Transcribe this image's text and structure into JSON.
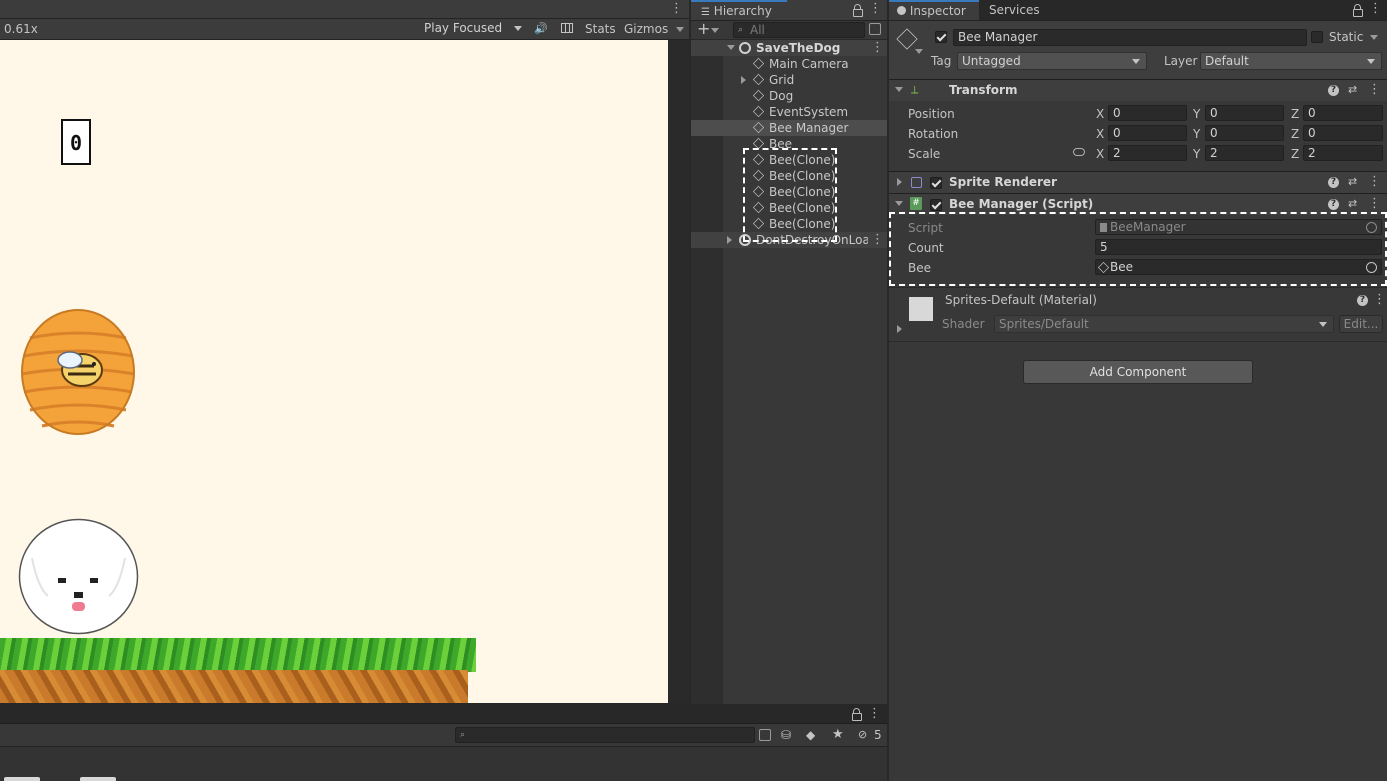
{
  "game_toolbar": {
    "zoom": "0.61x",
    "play_mode": "Play Focused",
    "stats": "Stats",
    "gizmos": "Gizmos"
  },
  "game_view": {
    "score": "0",
    "background_color": "#fff8e8"
  },
  "hierarchy": {
    "tab": "Hierarchy",
    "search_placeholder": "All",
    "scene": "SaveTheDog",
    "items": [
      {
        "label": "Main Camera"
      },
      {
        "label": "Grid"
      },
      {
        "label": "Dog"
      },
      {
        "label": "EventSystem"
      },
      {
        "label": "Bee Manager"
      },
      {
        "label": "Bee"
      },
      {
        "label": "Bee(Clone)"
      },
      {
        "label": "Bee(Clone)"
      },
      {
        "label": "Bee(Clone)"
      },
      {
        "label": "Bee(Clone)"
      },
      {
        "label": "Bee(Clone)"
      }
    ],
    "dont_destroy": "DontDestroyOnLoad"
  },
  "inspector": {
    "tab": "Inspector",
    "services_tab": "Services",
    "object_name": "Bee Manager",
    "static_label": "Static",
    "tag_label": "Tag",
    "tag_value": "Untagged",
    "layer_label": "Layer",
    "layer_value": "Default",
    "transform": {
      "title": "Transform",
      "position": {
        "label": "Position",
        "x": "0",
        "y": "0",
        "z": "0"
      },
      "rotation": {
        "label": "Rotation",
        "x": "0",
        "y": "0",
        "z": "0"
      },
      "scale": {
        "label": "Scale",
        "x": "2",
        "y": "2",
        "z": "2"
      }
    },
    "axis": {
      "x": "X",
      "y": "Y",
      "z": "Z"
    },
    "sprite_renderer": {
      "title": "Sprite Renderer"
    },
    "script_component": {
      "title": "Bee Manager (Script)",
      "script_label": "Script",
      "script_value": "BeeManager",
      "count_label": "Count",
      "count_value": "5",
      "bee_label": "Bee",
      "bee_value": "Bee"
    },
    "material": {
      "title": "Sprites-Default (Material)",
      "shader_label": "Shader",
      "shader_value": "Sprites/Default",
      "edit": "Edit..."
    },
    "add_component": "Add Component"
  },
  "project": {
    "hidden_count": "5"
  },
  "colors": {
    "accent": "#3a79bb",
    "panel": "#383838"
  }
}
